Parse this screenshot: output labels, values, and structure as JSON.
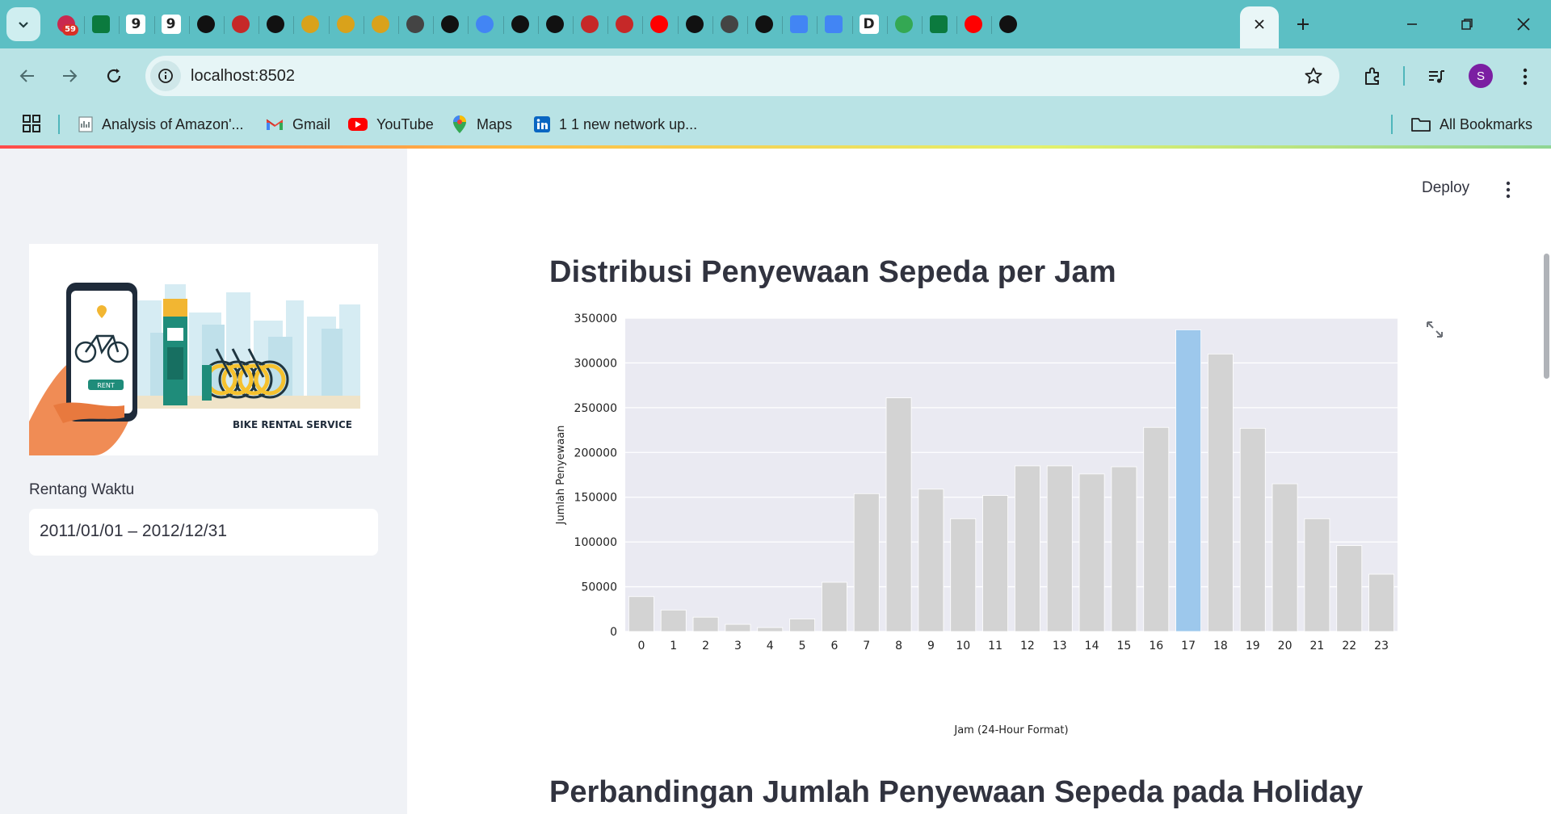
{
  "browser": {
    "tab_favicons": [
      {
        "icon": "notification-icon",
        "badge": "59",
        "color": "#c9294f"
      },
      {
        "icon": "square-app-icon",
        "color": "#0b7a3e"
      },
      {
        "icon": "letter-g-icon",
        "glyph": "9",
        "color": "#222222"
      },
      {
        "icon": "letter-g-icon",
        "glyph": "9",
        "color": "#222222"
      },
      {
        "icon": "github-icon",
        "color": "#111111"
      },
      {
        "icon": "crown-icon",
        "color": "#c62828"
      },
      {
        "icon": "github-icon",
        "color": "#111111"
      },
      {
        "icon": "link-icon",
        "color": "#d9a21b"
      },
      {
        "icon": "link-icon",
        "color": "#d9a21b"
      },
      {
        "icon": "link-icon",
        "color": "#d9a21b"
      },
      {
        "icon": "chrome-icon",
        "color": "#444444"
      },
      {
        "icon": "crown-icon",
        "color": "#111111"
      },
      {
        "icon": "google-icon",
        "color": "#4285f4"
      },
      {
        "icon": "chatgpt-icon",
        "color": "#111111"
      },
      {
        "icon": "crown-icon",
        "color": "#111111"
      },
      {
        "icon": "crown-icon",
        "color": "#c62828"
      },
      {
        "icon": "crown-icon",
        "color": "#c62828"
      },
      {
        "icon": "youtube-icon",
        "color": "#ff0000"
      },
      {
        "icon": "github-icon",
        "color": "#111111"
      },
      {
        "icon": "chrome-icon",
        "color": "#444444"
      },
      {
        "icon": "crown-icon",
        "color": "#111111"
      },
      {
        "icon": "docs-icon",
        "color": "#4285f4"
      },
      {
        "icon": "docs-icon",
        "color": "#4285f4"
      },
      {
        "icon": "letter-d-icon",
        "glyph": "D",
        "color": "#222222"
      },
      {
        "icon": "drive-icon",
        "color": "#34a853"
      },
      {
        "icon": "square-app-icon",
        "color": "#0b7a3e"
      },
      {
        "icon": "youtube-icon",
        "color": "#ff0000"
      },
      {
        "icon": "crown-icon",
        "color": "#111111"
      }
    ],
    "url": "localhost:8502",
    "profile_initial": "S",
    "bookmarks": [
      {
        "label": "Analysis of Amazon'...",
        "icon": "bookmark-page-icon"
      },
      {
        "label": "Gmail",
        "icon": "gmail-icon"
      },
      {
        "label": "YouTube",
        "icon": "youtube-icon"
      },
      {
        "label": "Maps",
        "icon": "maps-icon"
      },
      {
        "label": "1 1 new network up...",
        "icon": "linkedin-icon"
      }
    ],
    "all_bookmarks_label": "All Bookmarks"
  },
  "app": {
    "deploy_label": "Deploy",
    "sidebar": {
      "image_caption": "BIKE RENTAL SERVICE",
      "image_badge": "RENT",
      "date_label": "Rentang Waktu",
      "date_value": "2011/01/01 – 2012/12/31"
    },
    "chart_title": "Distribusi Penyewaan Sepeda per Jam",
    "second_title": "Perbandingan Jumlah Penyewaan Sepeda pada Holiday"
  },
  "colors": {
    "bar_default": "#d3d3d3",
    "bar_highlight": "#9dc8ec",
    "plot_bg": "#eaeaf2",
    "tab_bar": "#5cbfc4",
    "toolbar": "#b9e3e5"
  },
  "chart_data": {
    "type": "bar",
    "title": "",
    "xlabel": "Jam (24-Hour Format)",
    "ylabel": "Jumlah Penyewaan",
    "categories": [
      "0",
      "1",
      "2",
      "3",
      "4",
      "5",
      "6",
      "7",
      "8",
      "9",
      "10",
      "11",
      "12",
      "13",
      "14",
      "15",
      "16",
      "17",
      "18",
      "19",
      "20",
      "21",
      "22",
      "23"
    ],
    "values": [
      39000,
      24000,
      16000,
      8000,
      4400,
      14000,
      55000,
      154000,
      261000,
      159000,
      126000,
      152000,
      185000,
      185000,
      176000,
      184000,
      228000,
      337000,
      310000,
      227000,
      165000,
      126000,
      96000,
      64000
    ],
    "highlight_index": 17,
    "ylim": [
      0,
      350000
    ],
    "yticks": [
      "0",
      "50000",
      "100000",
      "150000",
      "200000",
      "250000",
      "300000",
      "350000"
    ],
    "grid": true,
    "legend": "none"
  }
}
